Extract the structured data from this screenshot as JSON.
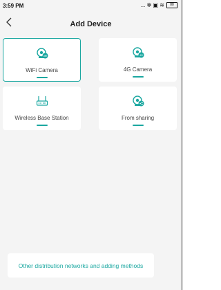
{
  "status": {
    "time": "3:59 PM",
    "icons_text": "... ✻ ▣ ≋",
    "battery": "88"
  },
  "header": {
    "back_icon": "chevron-left-icon",
    "title": "Add Device"
  },
  "devices": [
    {
      "label": "WiFi Camera",
      "icon": "wifi-camera-icon",
      "selected": true
    },
    {
      "label": "4G Camera",
      "icon": "4g-camera-icon",
      "selected": false
    },
    {
      "label": "Wireless Base Station",
      "icon": "base-station-icon",
      "selected": false
    },
    {
      "label": "From sharing",
      "icon": "share-camera-icon",
      "selected": false
    }
  ],
  "footer": {
    "button_label": "Other distribution networks and adding methods"
  },
  "colors": {
    "accent": "#1aa7a0",
    "background": "#f4f4f4"
  }
}
